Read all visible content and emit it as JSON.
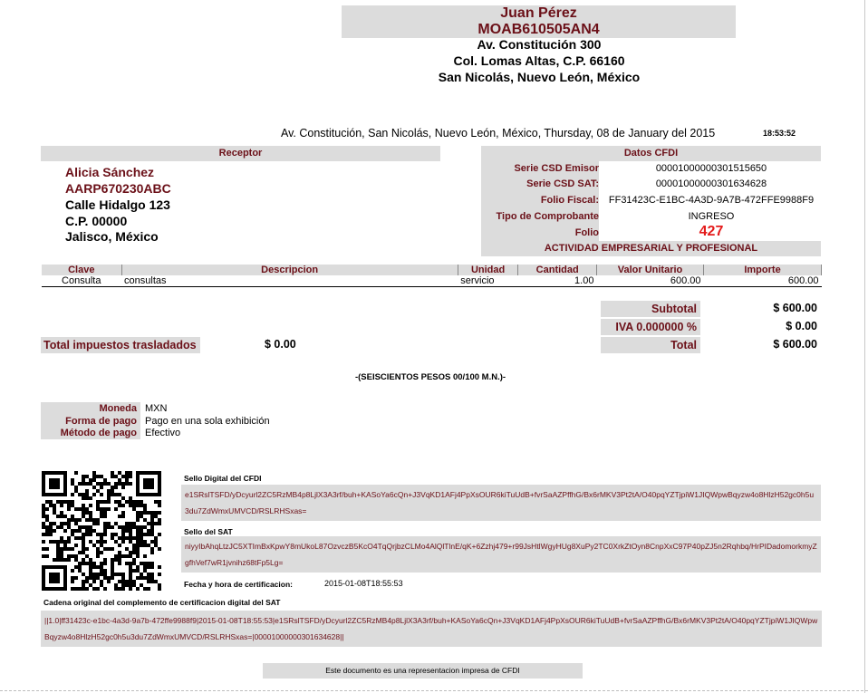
{
  "emisor": {
    "name": "Juan Pérez",
    "rfc": "MOAB610505AN4",
    "address_1": "Av. Constitución 300",
    "address_2": "Col. Lomas Altas, C.P. 66160",
    "address_3": "San Nicolás, Nuevo León, México"
  },
  "place_date": "Av. Constitución, San Nicolás, Nuevo León, México, Thursday, 08 de January del 2015",
  "time": "18:53:52",
  "receptor": {
    "title": "Receptor",
    "name": "Alicia Sánchez",
    "rfc": "AARP670230ABC",
    "street": "Calle Hidalgo 123",
    "cp": "C.P. 00000",
    "state": "Jalisco, México"
  },
  "cfdi": {
    "title": "Datos CFDI",
    "rows": [
      {
        "label": "Serie CSD Emisor",
        "value": "00001000000301515650"
      },
      {
        "label": "Serie CSD SAT:",
        "value": "00001000000301634628"
      },
      {
        "label": "Folio Fiscal:",
        "value": "FF31423C-E1BC-4A3D-9A7B-472FFE9988F9"
      },
      {
        "label": "Tipo de Comprobante",
        "value": "INGRESO"
      },
      {
        "label": "Folio",
        "value": "427"
      }
    ],
    "regime": "ACTIVIDAD EMPRESARIAL Y PROFESIONAL"
  },
  "items": {
    "headers": [
      "Clave",
      "Descripcion",
      "Unidad",
      "Cantidad",
      "Valor Unitario",
      "Importe"
    ],
    "rows": [
      [
        "Consulta",
        "consultas",
        "servicio",
        "1.00",
        "600.00",
        "600.00"
      ]
    ]
  },
  "totals": {
    "subtotal_label": "Subtotal",
    "subtotal_value": "$ 600.00",
    "iva_label": "IVA 0.000000 %",
    "iva_value": "$ 0.00",
    "total_label": "Total",
    "total_value": "$ 600.00",
    "taxes_label": "Total impuestos trasladados",
    "taxes_value": "$ 0.00"
  },
  "amount_words": "-(SEISCIENTOS PESOS 00/100 M.N.)-",
  "payment": [
    {
      "label": "Moneda",
      "value": "MXN"
    },
    {
      "label": "Forma de pago",
      "value": "Pago en una sola exhibición"
    },
    {
      "label": "Método de pago",
      "value": "Efectivo"
    }
  ],
  "stamp": {
    "cfdi_seal_title": "Sello Digital del CFDI",
    "cfdi_seal": "e1SRslTSFD/yDcyurl2ZC5RzMB4p8LjlX3A3rf/buh+KASoYa6cQn+J3VqKD1AFj4PpXsOUR6kiTuUdB+fvrSaAZPffhG/Bx6rMKV3Pt2tA/O40pqYZTjpiW1JIQWpwBqyzw4o8HlzH52gc0h5u3du7ZdWmxUMVCD/RSLRHSxas=",
    "sat_seal_title": "Sello del SAT",
    "sat_seal": "niyyIbAhqLtzJC5XTImBxKpwY8mUkoL87OzvczB5KcO4TqQrjbzCLMo4AlQlTlnE/qK+6Zzhj479+r99JsHtlWgyHUg8XuPy2TC0XrkZtOyn8CnpXxC97P40pZJ5n2Rqhbq/HrPIDadomorkmyZgfhVef7wR1jvnihz68tFp5Lg=",
    "cert_label": "Fecha y hora de certificacion:",
    "cert_value": "2015-01-08T18:55:53",
    "chain_title": "Cadena original del complemento de certificacion digital del SAT",
    "chain": "||1.0|ff31423c-e1bc-4a3d-9a7b-472ffe9988f9|2015-01-08T18:55:53|e1SRslTSFD/yDcyurl2ZC5RzMB4p8LjlX3A3rf/buh+KASoYa6cQn+J3VqKD1AFj4PpXsOUR6kiTuUdB+fvrSaAZPffhG/Bx6rMKV3Pt2tA/O40pqYZTjpiW1JIQWpwBqyzw4o8HlzH52gc0h5u3du7ZdWmxUMVCD/RSLRHSxas=|00001000000301634628||"
  },
  "footer": "Este documento es una representacion impresa de CFDI",
  "colors": {
    "accent": "#6b1018",
    "panel": "#dcdcdc",
    "folio": "#e41b1b"
  }
}
